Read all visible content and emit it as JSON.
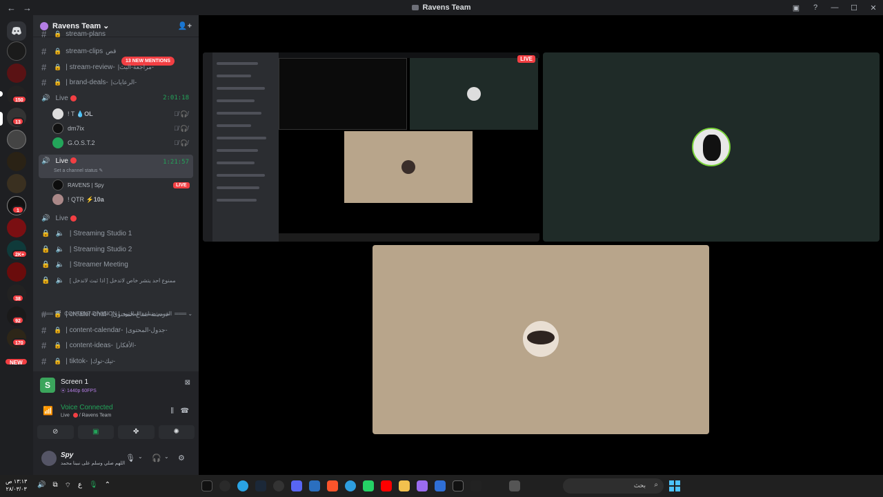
{
  "window": {
    "title": "Ravens Team",
    "nav_back": "←",
    "nav_fwd": "→",
    "ctrl_inbox": "▣",
    "ctrl_help": "?",
    "ctrl_min": "—",
    "ctrl_max": "☐",
    "ctrl_close": "✕"
  },
  "guild": {
    "name": "Ravens Team",
    "chevron": "⌄"
  },
  "mentions_banner": "13 NEW MENTIONS",
  "server_badges": [
    "150",
    "13",
    "1",
    "2K+",
    "38",
    "92",
    "170"
  ],
  "new_badge": "NEW",
  "channels_top": [
    {
      "name": "stream-plans",
      "rtl": "",
      "icon": "hash-lock"
    },
    {
      "name": "stream-clips",
      "rtl": "قص",
      "icon": "hash-lock"
    },
    {
      "name": "| stream-review-",
      "rtl": "|مراجعة-البث-",
      "icon": "hash-lock"
    },
    {
      "name": "| brand-deals-",
      "rtl": "|الرعايات-",
      "icon": "hash-lock"
    }
  ],
  "voice_live1": {
    "name": "Live",
    "timer": "2:01:18",
    "users": [
      {
        "name": "! T",
        "tag": "OL"
      },
      {
        "name": "dm7ix",
        "tag": ""
      },
      {
        "name": "G.O.S.T.2",
        "tag": ""
      }
    ]
  },
  "voice_live2": {
    "name": "Live",
    "timer": "1:21:57",
    "status": "Set a channel status",
    "users": [
      {
        "name": "RAVENS | Spy",
        "live": "LIVE"
      },
      {
        "name": "! QTR",
        "tag": "10a"
      }
    ]
  },
  "voice_other": [
    {
      "name": "Live"
    },
    {
      "name": "| Streaming Studio 1"
    },
    {
      "name": "| Streaming Studio 2"
    },
    {
      "name": "| Streamer Meeting"
    },
    {
      "name": "ممنوع احد يتشر خاص لاتدخل [ اذا ثبث لاتدخل ]"
    }
  ],
  "category": {
    "name": "CONTENT DIVISION | القسم صناعة المحتوى"
  },
  "channels_bottom": [
    {
      "name": "| creator-chat-",
      "rtl": "|دردشة-صناع-المحتوى-"
    },
    {
      "name": "| content-calendar-",
      "rtl": "|جدول-المحتوى-"
    },
    {
      "name": "| content-ideas-",
      "rtl": "|الأفكار-"
    },
    {
      "name": "| tiktok-",
      "rtl": "|تيك-توك-"
    }
  ],
  "screen_share": {
    "title": "Screen 1",
    "quality": "1440p 60FPS"
  },
  "voice_connected": {
    "title": "Voice Connected",
    "location": "Live",
    "server": "/ Ravens Team"
  },
  "user": {
    "name": "Spy",
    "status": "اللهم صلي وسلم على نبينا محمد"
  },
  "taskbar": {
    "time": "١٣:١٣ ص",
    "date": "٢٨/٠٣/٠٣",
    "lang": "ع",
    "search": "بحث"
  },
  "colors": {
    "green": "#23a55a",
    "red": "#f23f43",
    "accent": "#b47ee5",
    "tile_dark": "#1f2b28",
    "tile_tan": "#b8a58b"
  }
}
